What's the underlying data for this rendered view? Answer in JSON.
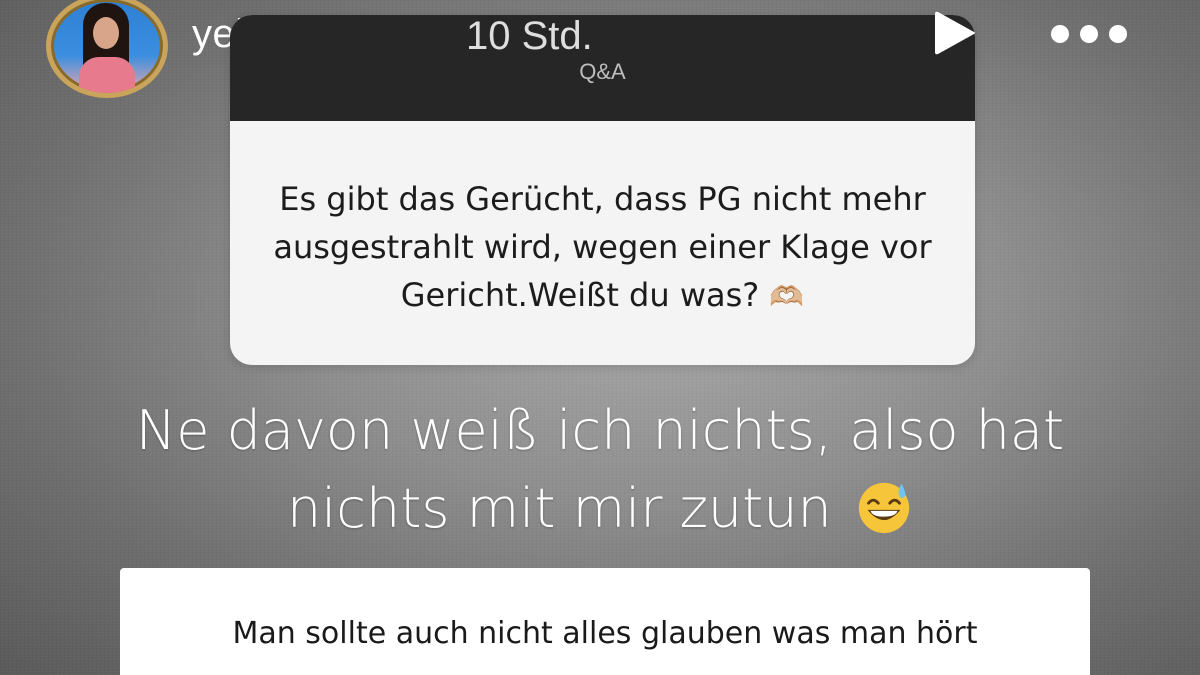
{
  "header": {
    "username": "yelizkoc",
    "timestamp": "10 Std.",
    "verified_icon": "verified-badge-icon",
    "play_icon": "play-icon",
    "more_icon": "more-options-icon"
  },
  "qa_card": {
    "label": "Q&A",
    "question": "Es gibt das Gerücht, dass PG nicht mehr ausgestrahlt wird, wegen einer Klage vor Gericht.Weißt du was?",
    "question_emoji": "🫶🏼"
  },
  "answer": {
    "text": "Ne davon weiß ich nichts, also hat nichts mit mir zutun",
    "emoji_icon": "grinning-sweat-emoji"
  },
  "bottom_card": {
    "text": "Man sollte auch nicht alles glauben was man hört"
  },
  "colors": {
    "accent_gold": "#c9a45a",
    "qa_header": "#262626",
    "card_bg": "#f4f4f4"
  }
}
